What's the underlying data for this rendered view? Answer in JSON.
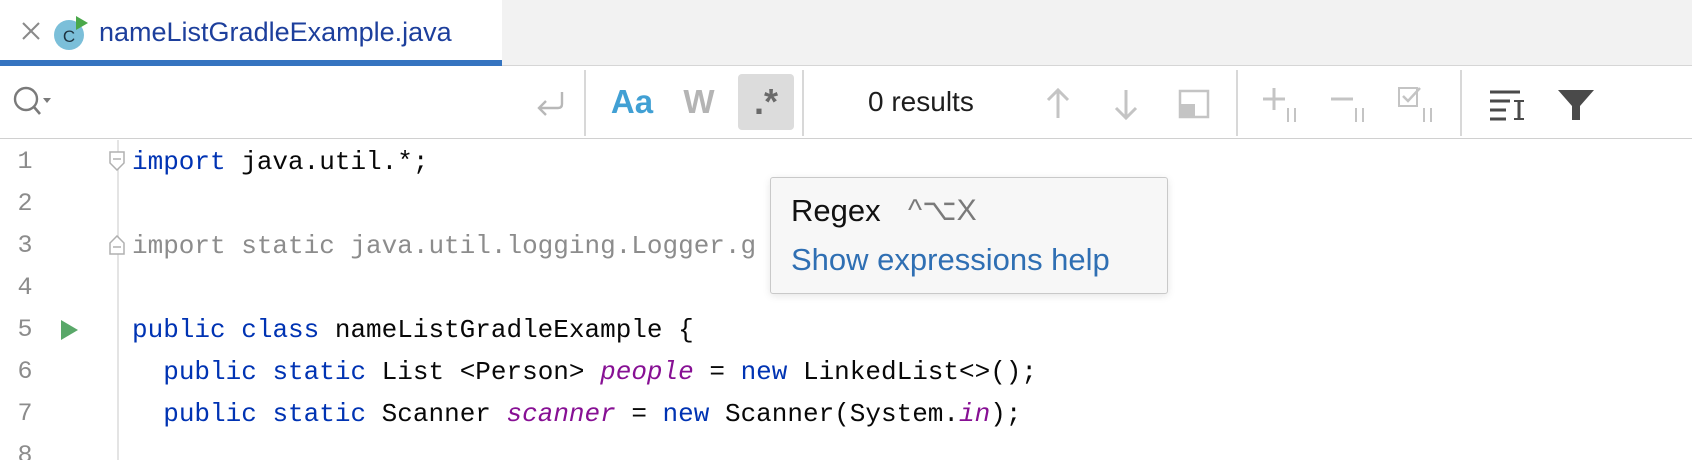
{
  "tab": {
    "title": "nameListGradleExample.java",
    "icon": "java-class-run-icon",
    "file_badge": "C"
  },
  "search": {
    "value": "",
    "placeholder": "",
    "case_label": "Aa",
    "words_label": "W",
    "regex_label": ".*",
    "results": "0 results",
    "icons": [
      "search-icon",
      "soft-wrap-icon",
      "arrow-up-icon",
      "arrow-down-icon",
      "open-in-window-icon",
      "add-occurrence-icon",
      "remove-occurrence-icon",
      "select-all-occurrences-icon",
      "filter-search-results-icon",
      "filter-icon"
    ]
  },
  "tooltip": {
    "title": "Regex",
    "shortcut": "^⌥X",
    "link": "Show expressions help"
  },
  "editor": {
    "line_numbers": [
      "1",
      "2",
      "3",
      "4",
      "5",
      "6",
      "7",
      "8"
    ],
    "lines": {
      "l1": {
        "kw": "import",
        "rest": " java.util.*;"
      },
      "l3": {
        "text": "import static java.util.logging.Logger.g"
      },
      "l5": {
        "kw1": "public",
        "kw2": "class",
        "rest": " nameListGradleExample {"
      },
      "l6": {
        "indent": "  ",
        "kw1": "public",
        "kw2": "static",
        "mid": " List <Person> ",
        "field": "people",
        "eq": " = ",
        "kw3": "new",
        "rest": " LinkedList<>();"
      },
      "l7": {
        "indent": "  ",
        "kw1": "public",
        "kw2": "static",
        "mid": " Scanner ",
        "field": "scanner",
        "eq": " = ",
        "kw3": "new",
        "mid2": " Scanner(System.",
        "field2": "in",
        "rest": ");"
      }
    }
  },
  "colors": {
    "accent": "#3574c0",
    "keyword": "#0033b3",
    "field": "#871094",
    "link": "#2f6fb3",
    "run_green": "#59a869"
  }
}
